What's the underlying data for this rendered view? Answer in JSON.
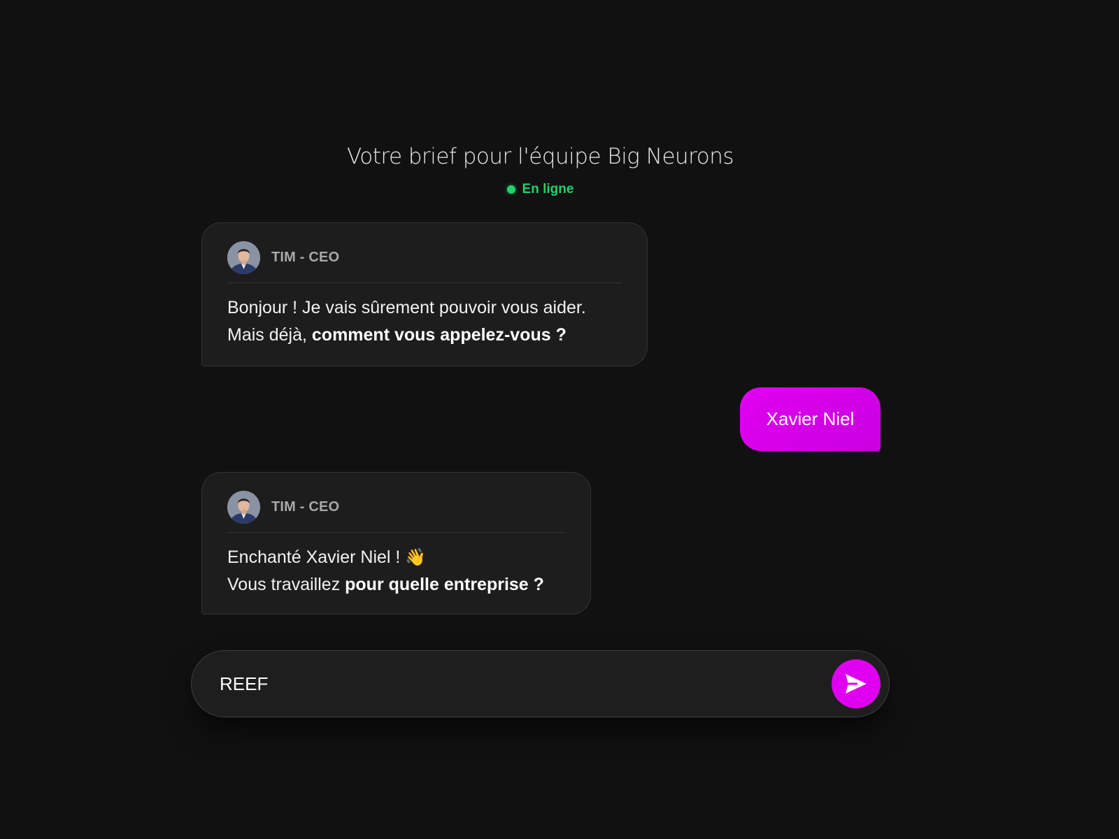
{
  "header": {
    "title": "Votre brief pour l'équipe Big Neurons",
    "status": "En ligne"
  },
  "messages": [
    {
      "author": "TIM - CEO",
      "line1": "Bonjour ! Je vais sûrement pouvoir vous aider.",
      "line2_plain": "Mais déjà, ",
      "line2_bold": "comment vous appelez-vous ?"
    },
    {
      "user_text": "Xavier Niel"
    },
    {
      "author": "TIM - CEO",
      "line1": "Enchanté Xavier Niel ! ",
      "line1_emoji": "👋",
      "line2_plain": "Vous travaillez ",
      "line2_bold": "pour quelle entreprise ?"
    }
  ],
  "composer": {
    "value": "REEF"
  },
  "colors": {
    "accent": "#e000f0",
    "online": "#22d16a",
    "background": "#111111",
    "bubble": "#1d1d1d"
  },
  "icons": {
    "send": "paper-plane-icon",
    "online": "status-dot-icon"
  }
}
